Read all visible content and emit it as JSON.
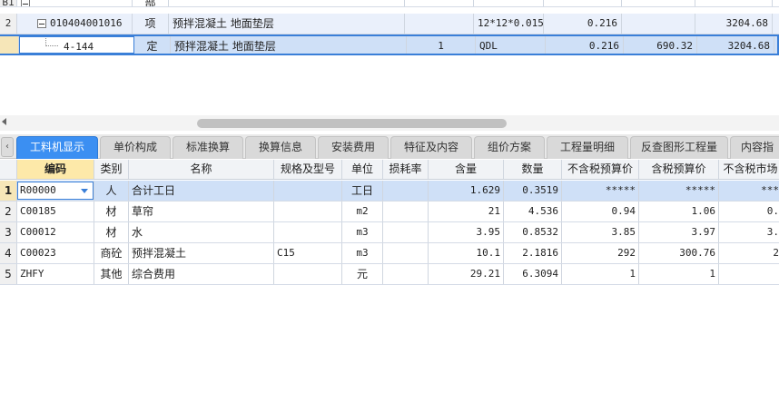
{
  "top_grid": {
    "partial_row": {
      "num": "B1",
      "type": "部"
    },
    "rows": [
      {
        "num": "2",
        "code": "010404001016",
        "type": "项",
        "name": "预拌混凝土 地面垫层",
        "qty": "",
        "expr": "12*12*0.015",
        "amount": "0.216",
        "price": "",
        "total": "3204.68"
      },
      {
        "num": "",
        "code": "4-144",
        "type": "定",
        "name": "预拌混凝土 地面垫层",
        "qty": "1",
        "expr": "QDL",
        "amount": "0.216",
        "price": "690.32",
        "total": "3204.68"
      }
    ]
  },
  "tabs": [
    {
      "label": "工料机显示",
      "active": true
    },
    {
      "label": "单价构成"
    },
    {
      "label": "标准换算"
    },
    {
      "label": "换算信息"
    },
    {
      "label": "安装费用"
    },
    {
      "label": "特征及内容"
    },
    {
      "label": "组价方案"
    },
    {
      "label": "工程量明细"
    },
    {
      "label": "反查图形工程量"
    },
    {
      "label": "内容指"
    }
  ],
  "tab_scroll_icon": "chevron-left-icon",
  "grid": {
    "headers": [
      "编码",
      "类别",
      "名称",
      "规格及型号",
      "单位",
      "损耗率",
      "含量",
      "数量",
      "不含税预算价",
      "含税预算价",
      "不含税市场"
    ],
    "rows": [
      {
        "num": "1",
        "code": "R00000",
        "cat": "人",
        "name": "合计工日",
        "spec": "",
        "unit": "工日",
        "loss": "",
        "content": "1.629",
        "qty": "0.3519",
        "price_ex": "*****",
        "price_in": "*****",
        "market": "***"
      },
      {
        "num": "2",
        "code": "C00185",
        "cat": "材",
        "name": "草帘",
        "spec": "",
        "unit": "m2",
        "loss": "",
        "content": "21",
        "qty": "4.536",
        "price_ex": "0.94",
        "price_in": "1.06",
        "market": "0."
      },
      {
        "num": "3",
        "code": "C00012",
        "cat": "材",
        "name": "水",
        "spec": "",
        "unit": "m3",
        "loss": "",
        "content": "3.95",
        "qty": "0.8532",
        "price_ex": "3.85",
        "price_in": "3.97",
        "market": "3."
      },
      {
        "num": "4",
        "code": "C00023",
        "cat": "商砼",
        "name": "预拌混凝土",
        "spec": "C15",
        "unit": "m3",
        "loss": "",
        "content": "10.1",
        "qty": "2.1816",
        "price_ex": "292",
        "price_in": "300.76",
        "market": "2"
      },
      {
        "num": "5",
        "code": "ZHFY",
        "cat": "其他",
        "name": "综合费用",
        "spec": "",
        "unit": "元",
        "loss": "",
        "content": "29.21",
        "qty": "6.3094",
        "price_ex": "1",
        "price_in": "1",
        "market": ""
      }
    ]
  }
}
